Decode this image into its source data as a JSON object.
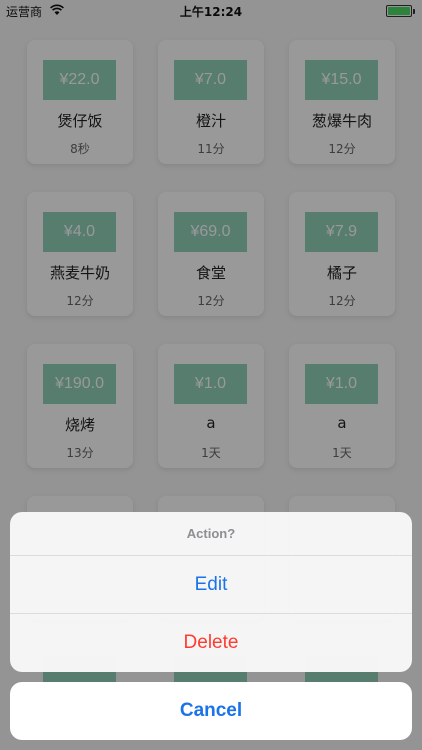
{
  "status_bar": {
    "carrier": "运营商",
    "time": "上午12:24"
  },
  "items": [
    {
      "price": "¥22.0",
      "name": "煲仔饭",
      "time": "8秒"
    },
    {
      "price": "¥7.0",
      "name": "橙汁",
      "time": "11分"
    },
    {
      "price": "¥15.0",
      "name": "葱爆牛肉",
      "time": "12分"
    },
    {
      "price": "¥4.0",
      "name": "燕麦牛奶",
      "time": "12分"
    },
    {
      "price": "¥69.0",
      "name": "食堂",
      "time": "12分"
    },
    {
      "price": "¥7.9",
      "name": "橘子",
      "time": "12分"
    },
    {
      "price": "¥190.0",
      "name": "烧烤",
      "time": "13分"
    },
    {
      "price": "¥1.0",
      "name": "a",
      "time": "1天"
    },
    {
      "price": "¥1.0",
      "name": "a",
      "time": "1天"
    }
  ],
  "action_sheet": {
    "title": "Action?",
    "edit_label": "Edit",
    "delete_label": "Delete",
    "cancel_label": "Cancel"
  },
  "colors": {
    "price_bg": "#8fd0b8",
    "accent": "#1a73e8",
    "destructive": "#ff3b30",
    "battery": "#4cd964"
  }
}
